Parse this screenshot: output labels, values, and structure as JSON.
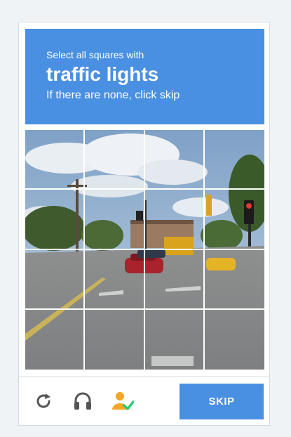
{
  "challenge": {
    "instruction": "Select all squares with",
    "target": "traffic lights",
    "hint": "If there are none, click skip"
  },
  "grid": {
    "rows": 4,
    "cols": 4,
    "image_content": "street-intersection-with-traffic-lights"
  },
  "footer": {
    "icons": [
      "reload-icon",
      "audio-icon",
      "info-icon"
    ],
    "skip_label": "SKIP"
  },
  "colors": {
    "accent": "#4a90e2",
    "info_person": "#f5a623",
    "info_check": "#2ecc71"
  }
}
